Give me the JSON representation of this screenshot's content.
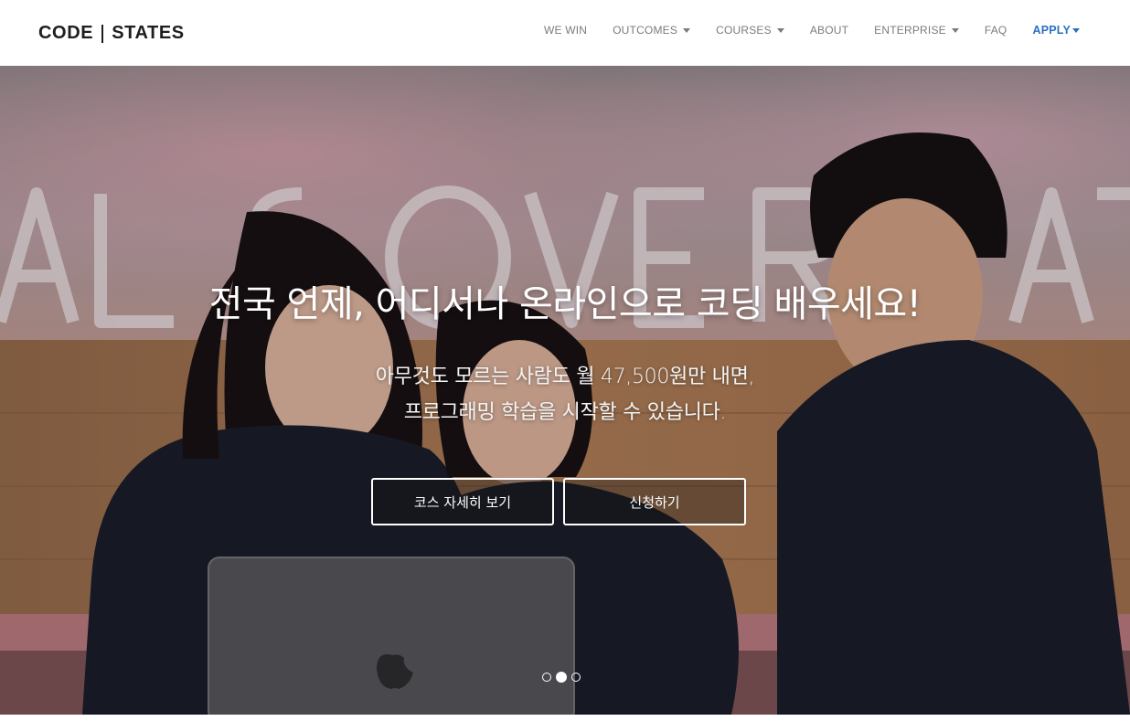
{
  "header": {
    "logo": {
      "left": "CODE",
      "right": "STATES"
    },
    "nav": [
      {
        "label": "WE WIN",
        "dropdown": false
      },
      {
        "label": "OUTCOMES",
        "dropdown": true
      },
      {
        "label": "COURSES",
        "dropdown": true
      },
      {
        "label": "ABOUT",
        "dropdown": false
      },
      {
        "label": "ENTERPRISE",
        "dropdown": true
      },
      {
        "label": "FAQ",
        "dropdown": false
      },
      {
        "label": "APPLY",
        "dropdown": true,
        "highlight": true
      }
    ]
  },
  "hero": {
    "title": "전국 언제, 어디서나 온라인으로 코딩 배우세요!",
    "subtitle_line1": "아무것도 모르는 사람도 월 47,500원만 내면,",
    "subtitle_line2": "프로그래밍 학습을 시작할 수 있습니다.",
    "buttons": [
      {
        "label": "코스 자세히 보기"
      },
      {
        "label": "신청하기"
      }
    ],
    "slides": 3,
    "active_slide": 2
  },
  "colors": {
    "accent": "#2b6fc4",
    "logo": "#1d1d22",
    "nav_text": "#7b7b7b"
  }
}
